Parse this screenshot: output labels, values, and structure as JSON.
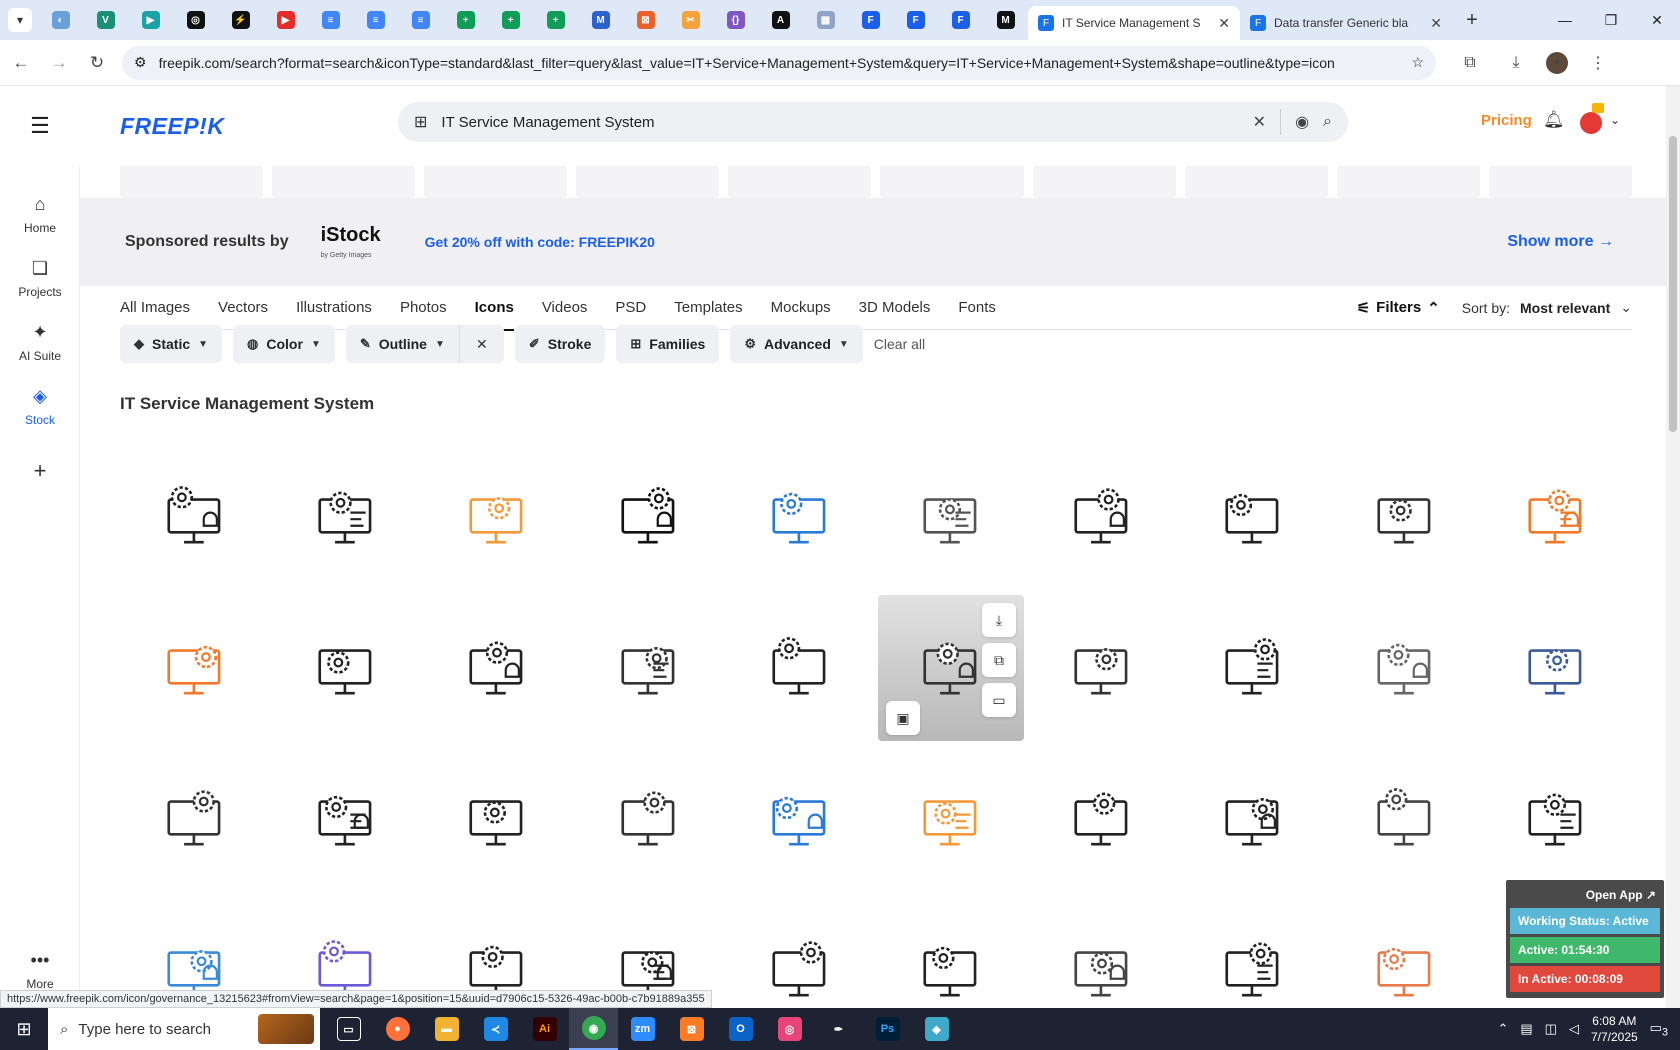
{
  "browser": {
    "tabs": [
      {
        "label": "IT Service Management S",
        "active": true,
        "icon": "freepik-tab-icon"
      },
      {
        "label": "Data transfer Generic bla",
        "active": false,
        "icon": "freepik-tab-icon"
      }
    ],
    "pinned_count": 22,
    "url": "freepik.com/search?format=search&iconType=standard&last_filter=query&last_value=IT+Service+Management+System&query=IT+Service+Management+System&shape=outline&type=icon"
  },
  "header": {
    "logo": "FREEP!K",
    "search_value": "IT Service Management System",
    "pricing": "Pricing"
  },
  "sidebar": {
    "items": [
      {
        "label": "Home",
        "icon": "home-icon"
      },
      {
        "label": "Projects",
        "icon": "projects-icon"
      },
      {
        "label": "AI Suite",
        "icon": "sparkle-icon"
      },
      {
        "label": "Stock",
        "icon": "stock-icon"
      },
      {
        "label": "More",
        "icon": "more-icon"
      }
    ]
  },
  "sponsored": {
    "label": "Sponsored results by",
    "brand": "iStock",
    "brand_sub": "by Getty Images",
    "promo": "Get 20% off with code: FREEPIK20",
    "show_more": "Show more →"
  },
  "categories": [
    "All Images",
    "Vectors",
    "Illustrations",
    "Photos",
    "Icons",
    "Videos",
    "PSD",
    "Templates",
    "Mockups",
    "3D Models",
    "Fonts"
  ],
  "active_category": "Icons",
  "filters_label": "Filters",
  "sort": {
    "label": "Sort by:",
    "value": "Most relevant"
  },
  "chips": {
    "static": "Static",
    "color": "Color",
    "outline": "Outline",
    "stroke": "Stroke",
    "families": "Families",
    "advanced": "Advanced",
    "clear_all": "Clear all"
  },
  "section_title": "IT Service Management System",
  "status_url": "https://www.freepik.com/icon/governance_13215623#fromView=search&page=1&position=15&uuid=d7906c15-5326-49ac-b00b-c7b91889a355",
  "widget": {
    "open_app": "Open App ↗",
    "status": "Working Status: Active",
    "active": "Active: 01:54:30",
    "inactive": "In Active: 00:08:09"
  },
  "taskbar": {
    "search_placeholder": "Type here to search",
    "time": "6:08 AM",
    "date": "7/7/2025",
    "notifications": "3"
  },
  "colors": {
    "brand_blue": "#1b5ee8",
    "pricing_orange": "#f28b2b",
    "accent_orange": "#f29a3a"
  }
}
